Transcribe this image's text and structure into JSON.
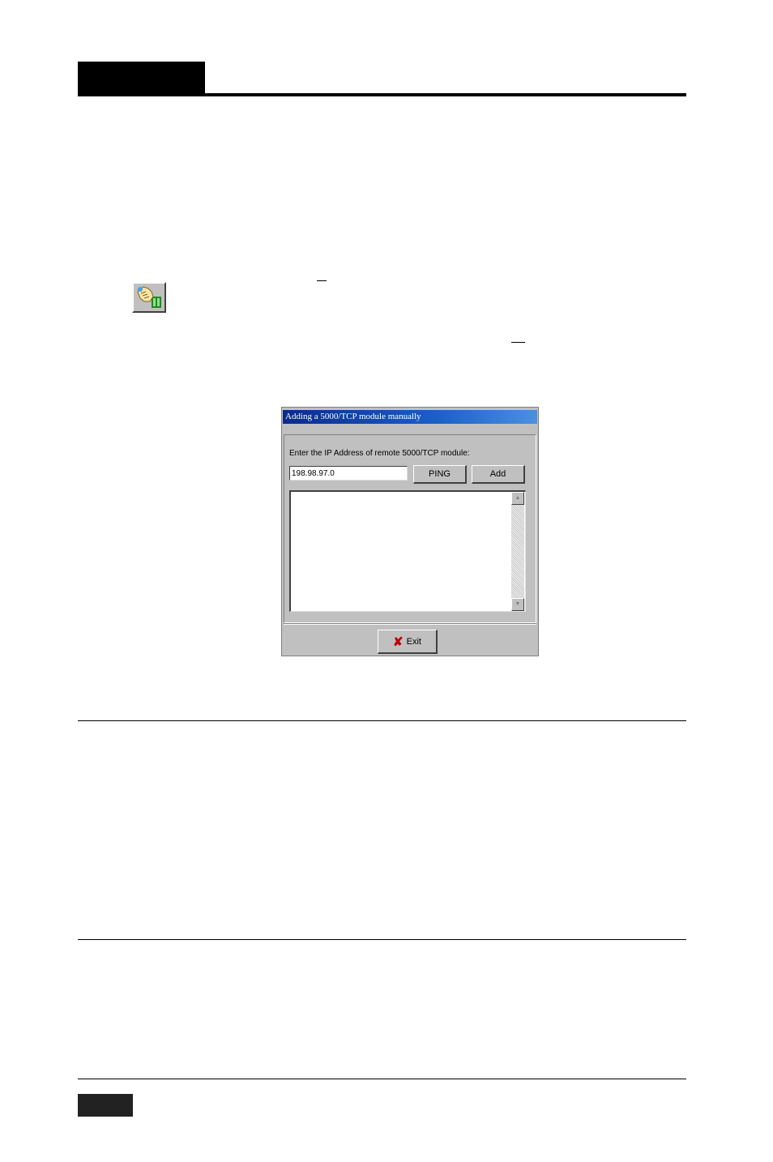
{
  "dialog": {
    "title": "Adding a 5000/TCP module manually",
    "prompt": "Enter the IP Address of remote 5000/TCP module:",
    "ip_value": "198.98.97.0",
    "ping_label": "PING",
    "add_label": "Add",
    "exit_label": "Exit",
    "scroll_up_icon": "scroll-up-arrow",
    "scroll_down_icon": "scroll-down-arrow"
  },
  "toolbar": {
    "icon": "add-module-hand-icon"
  }
}
